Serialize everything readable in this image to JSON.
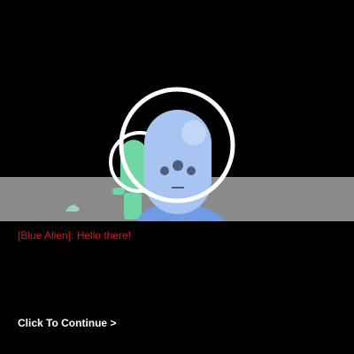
{
  "scene": {
    "characters": [
      {
        "name": "green-alien",
        "color": "#6fd6a4"
      },
      {
        "name": "blue-alien",
        "color": "#a8c4f2"
      }
    ],
    "backdrop_color": "#8a8a8a",
    "helmet_ring_color": "#ffffff"
  },
  "dialogue": {
    "text": "[Blue Alien]: Hello there!",
    "color": "#cc1a1a"
  },
  "controls": {
    "continue_label": "Click To Continue >"
  }
}
